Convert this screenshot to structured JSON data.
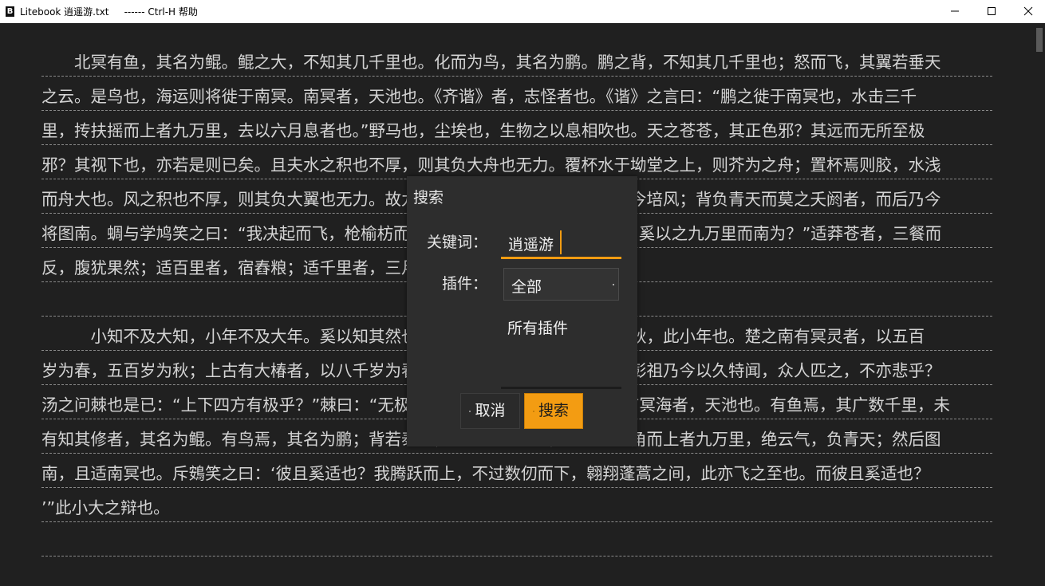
{
  "window": {
    "title": "Litebook 逍遥游.txt     ------ Ctrl-H 帮助",
    "icon": "litebook-app-icon"
  },
  "page": {
    "lines": [
      "　　北冥有鱼，其名为鲲。鲲之大，不知其几千里也。化而为鸟，其名为鹏。鹏之背，不知其几千里也；怒而飞，其翼若垂天",
      "之云。是鸟也，海运则将徙于南冥。南冥者，天池也。《齐谐》者，志怪者也。《谐》之言曰：“鹏之徙于南冥也，水击三千",
      "里，抟扶摇而上者九万里，去以六月息者也。”野马也，尘埃也，生物之以息相吹也。天之苍苍，其正色邪？其远而无所至极",
      "邪？其视下也，亦若是则已矣。且夫水之积也不厚，则其负大舟也无力。覆杯水于坳堂之上，则芥为之舟；置杯焉则胶，水浅",
      "而舟大也。风之积也不厚，则其负大翼也无力。故九万里，则风斯在下矣，而后乃今培风；背负青天而莫之夭阏者，而后乃今",
      "将图南。蜩与学鸠笑之曰：“我决起而飞，枪榆枋而止，时则不至而控于地而已矣，奚以之九万里而南为？”适莽苍者，三餐而",
      "反，腹犹果然；适百里者，宿舂粮；适千里者，三月聚粮。之二虫又何知！",
      "",
      "　　　小知不及大知，小年不及大年。奚以知其然也？朝菌不知晦朔，蟪蛄不知春秋，此小年也。楚之南有冥灵者，以五百",
      "岁为春，五百岁为秋；上古有大椿者，以八千岁为春，八千岁为秋，此大年也。而彭祖乃今以久特闻，众人匹之，不亦悲乎？",
      "汤之问棘也是已：“上下四方有极乎？”棘曰：“无极之外，复无极也。穷发之北，有冥海者，天池也。有鱼焉，其广数千里，未",
      "有知其修者，其名为鲲。有鸟焉，其名为鹏；背若泰山，翼若垂天之云，抟扶摇羊角而上者九万里，绝云气，负青天；然后图",
      "南，且适南冥也。斥鴳笑之曰：‘彼且奚适也？我腾跃而上，不过数仞而下，翱翔蓬蒿之间，此亦飞之至也。而彼且奚适也？",
      "’”此小大之辩也。",
      ""
    ]
  },
  "dialog": {
    "title": "搜索",
    "keyword_label": "关键词：",
    "keyword_value": "逍遥游",
    "plugin_label": "插件：",
    "plugin_selected": "全部",
    "dropdown_item": "所有插件",
    "cancel_label": "取消",
    "search_label": "搜索"
  },
  "colors": {
    "accent": "#f39c12",
    "background": "#202020",
    "dialog": "#2d2d2d",
    "text": "#d4d4d4"
  }
}
